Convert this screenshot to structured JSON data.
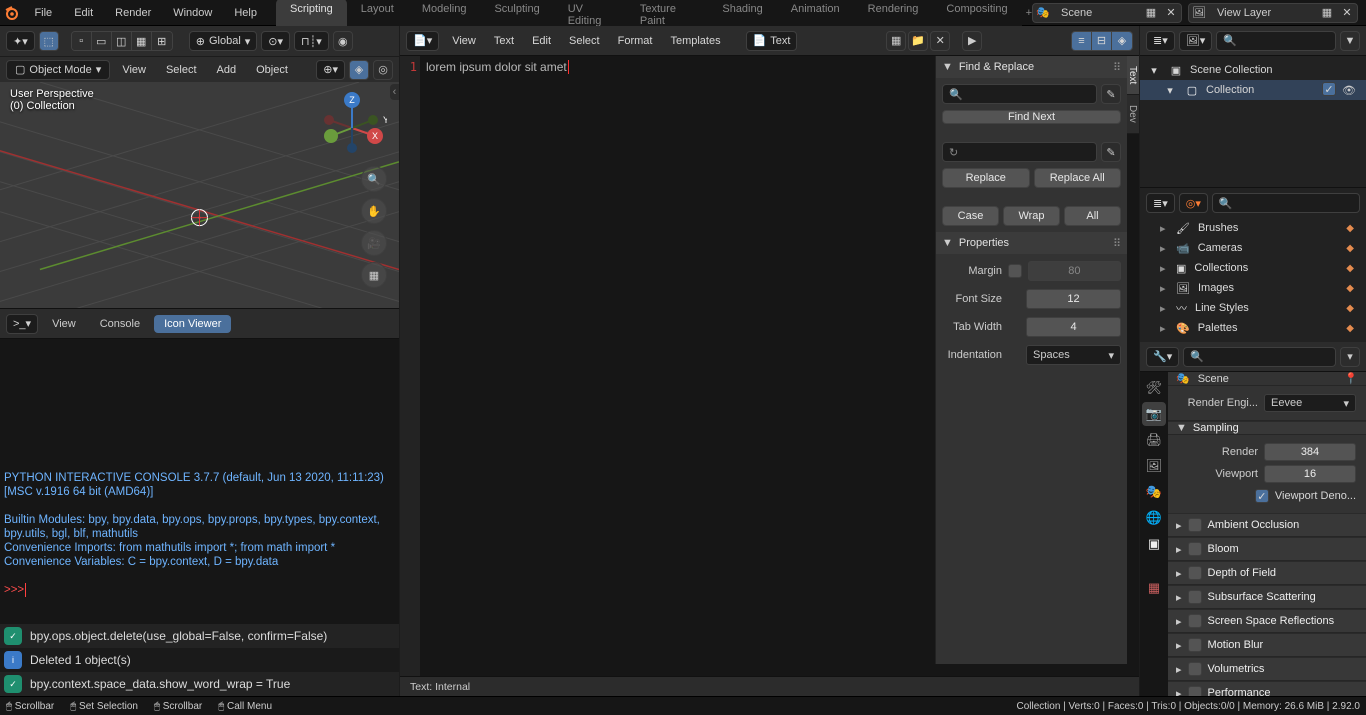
{
  "topmenu": [
    "File",
    "Edit",
    "Render",
    "Window",
    "Help"
  ],
  "workspaces": [
    "Scripting",
    "Layout",
    "Modeling",
    "Sculpting",
    "UV Editing",
    "Texture Paint",
    "Shading",
    "Animation",
    "Rendering",
    "Compositing"
  ],
  "active_ws": 0,
  "scene_field": "Scene",
  "viewlayer_field": "View Layer",
  "viewport": {
    "global": "Global",
    "mode": "Object Mode",
    "menus": [
      "View",
      "Select",
      "Add",
      "Object"
    ],
    "persp": "User Perspective",
    "coll": "(0) Collection"
  },
  "console": {
    "menus": [
      "View",
      "Console"
    ],
    "tab_icon": "Icon Viewer",
    "banner": "PYTHON INTERACTIVE CONSOLE 3.7.7 (default, Jun 13 2020, 11:11:23)  [MSC v.1916 64 bit (AMD64)]",
    "l3": "Builtin Modules:       bpy, bpy.data, bpy.ops, bpy.props, bpy.types, bpy.context, bpy.utils, bgl, blf, mathutils",
    "l4": "Convenience Imports:   from mathutils import *; from math import *",
    "l5": "Convenience Variables: C = bpy.context, D = bpy.data",
    "prompt": ">>> ",
    "reports": [
      {
        "type": "op",
        "text": "bpy.ops.object.delete(use_global=False, confirm=False)"
      },
      {
        "type": "info",
        "text": "Deleted 1 object(s)"
      },
      {
        "type": "op",
        "text": "bpy.context.space_data.show_word_wrap = True"
      }
    ]
  },
  "texteditor": {
    "menus": [
      "View",
      "Text",
      "Edit",
      "Select",
      "Format",
      "Templates"
    ],
    "name": "Text",
    "code": "lorem ipsum dolor sit amet",
    "footer": "Text: Internal",
    "find": {
      "title": "Find & Replace",
      "findnext": "Find Next",
      "replace": "Replace",
      "replaceall": "Replace All",
      "case": "Case",
      "wrap": "Wrap",
      "all": "All"
    },
    "props": {
      "title": "Properties",
      "margin_lbl": "Margin",
      "margin": "80",
      "font_lbl": "Font Size",
      "font": "12",
      "tab_lbl": "Tab Width",
      "tab": "4",
      "indent_lbl": "Indentation",
      "indent": "Spaces"
    }
  },
  "outliner": {
    "root": "Scene Collection",
    "child": "Collection"
  },
  "data_api": {
    "items": [
      "Brushes",
      "Cameras",
      "Collections",
      "Images",
      "Line Styles",
      "Palettes"
    ]
  },
  "props": {
    "scene": "Scene",
    "engine_lbl": "Render Engi...",
    "engine": "Eevee",
    "sampling": "Sampling",
    "render_lbl": "Render",
    "render": "384",
    "viewport_lbl": "Viewport",
    "viewport": "16",
    "vpdeno": "Viewport Deno...",
    "panels": [
      "Ambient Occlusion",
      "Bloom",
      "Depth of Field",
      "Subsurface Scattering",
      "Screen Space Reflections",
      "Motion Blur",
      "Volumetrics",
      "Performance"
    ]
  },
  "footer": {
    "k1": "Scrollbar",
    "k2": "Set Selection",
    "k3": "Scrollbar",
    "k4": "Call Menu",
    "stats": "Collection | Verts:0 | Faces:0 | Tris:0 | Objects:0/0 | Memory: 26.6 MiB | 2.92.0"
  }
}
